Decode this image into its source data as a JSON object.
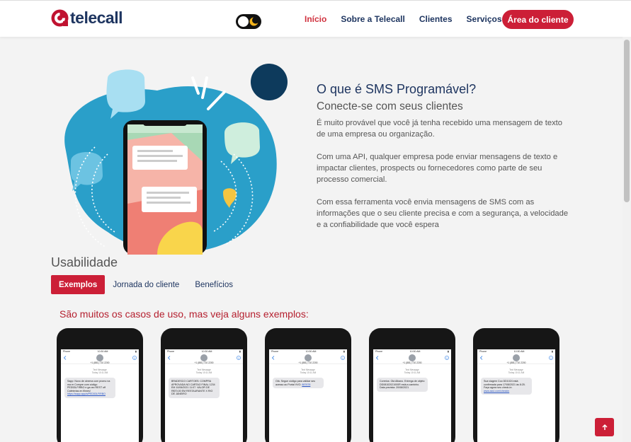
{
  "brand": {
    "name": "telecall",
    "accent": "#cc1f37",
    "navy": "#1e3560"
  },
  "nav": {
    "items": [
      {
        "label": "Início",
        "active": true
      },
      {
        "label": "Sobre a Telecall",
        "active": false
      },
      {
        "label": "Clientes",
        "active": false
      },
      {
        "label": "Serviços",
        "active": false,
        "dropdown": true
      }
    ],
    "cta": "Área do cliente"
  },
  "hero": {
    "title": "O que é SMS Programável?",
    "subtitle": "Conecte-se com seus clientes",
    "paragraphs": [
      "É muito provável que você já tenha recebido uma mensagem de texto de uma empresa ou organização.",
      "Com uma API, qualquer empresa pode enviar mensagens de texto e impactar clientes, prospects ou fornecedores como parte de seu processo comercial.",
      "Com essa ferramenta você envia mensagens de SMS com as informações que o seu cliente precisa e com a segurança, a velocidade e a confiabilidade que você espera"
    ]
  },
  "usability": {
    "title": "Usabilidade",
    "tabs": [
      {
        "label": "Exemplos",
        "active": true
      },
      {
        "label": "Jornada do cliente",
        "active": false
      },
      {
        "label": "Benefícios",
        "active": false
      }
    ],
    "examples_title": "São muitos os casos de uso, mas veja alguns exemplos:"
  },
  "phones": [
    {
      "carrier": "Phone",
      "time": "10:30 AM",
      "number": "+1 (881) 710 2200",
      "stamp": "Text Message\nToday 10:11 AM",
      "message": "Sapp: Novo de cinema com promo na ma er Compre com código PED53LFIRBO e ga ran REST off Cafeterias en filmes!",
      "link": "https://sapp.app/a/PED53LFIRBO"
    },
    {
      "carrier": "Phone",
      "time": "10:30 AM",
      "number": "+1 (881) 710 2200",
      "stamp": "Text Message\nToday 10:11 AM",
      "message": "BRADESCO CARTOES: COMPRA APROVADA NO CARTAO FINAL 1234 EM 10/06/2021 11:07. VALOR DE R$70,00 EM RESTAURANTE X RIO DE JANEIRO",
      "link": ""
    },
    {
      "carrier": "Phone",
      "time": "10:30 AM",
      "number": "+1 (881) 710 2200",
      "stamp": "Text Message\nToday 10:11 AM",
      "message": "Olá. Segue código para validar seu acesso ao Portal VVO:",
      "link": "887678"
    },
    {
      "carrier": "Phone",
      "time": "10:30 AM",
      "number": "+1 (881) 710 2200",
      "stamp": "Text Message\nToday 10:11 AM",
      "message": "Correios: Olá Albano. Entrega de objeto DD08102021000R está a caminho. Data prevista: 20/08/2021",
      "link": ""
    },
    {
      "carrier": "Phone",
      "time": "10:30 AM",
      "number": "+1 (881) 710 2200",
      "stamp": "Text Message\nToday 10:11 AM",
      "message": "Sua viagem Coo DD1024 está confirmada para 17/08/2021 às 8:25. Faça agora seu check-in:",
      "link": "www.azul.com/checkin"
    }
  ],
  "icons": [
    "toggle-moon-icon",
    "chevron-down-icon",
    "arrow-up-icon",
    "back-chevron-icon",
    "info-icon"
  ]
}
